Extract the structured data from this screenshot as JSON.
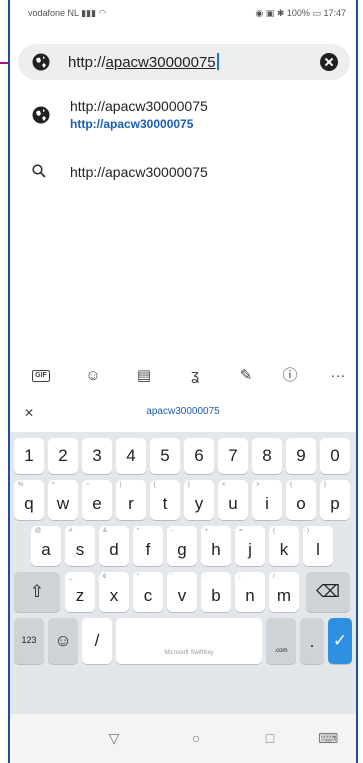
{
  "status_bar": {
    "carrier": "vodafone NL",
    "time": "17:47",
    "battery": "100%"
  },
  "url_bar": {
    "prefix": "http://",
    "typed": "apacw30000075"
  },
  "suggestions": [
    {
      "icon": "globe-icon",
      "title": "http://apacw30000075",
      "subtitle": "http://apacw30000075"
    },
    {
      "icon": "search-icon",
      "title": "http://apacw30000075"
    }
  ],
  "keyboard": {
    "suggestion_strip": "apacw30000075",
    "row_digits": [
      "1",
      "2",
      "3",
      "4",
      "5",
      "6",
      "7",
      "8",
      "9",
      "0"
    ],
    "row_q": [
      {
        "k": "q",
        "s": "%"
      },
      {
        "k": "w",
        "s": "^"
      },
      {
        "k": "e",
        "s": "~"
      },
      {
        "k": "r",
        "s": "|"
      },
      {
        "k": "t",
        "s": "["
      },
      {
        "k": "y",
        "s": "]"
      },
      {
        "k": "u",
        "s": "<"
      },
      {
        "k": "i",
        "s": ">"
      },
      {
        "k": "o",
        "s": "{"
      },
      {
        "k": "p",
        "s": "}"
      }
    ],
    "row_a": [
      {
        "k": "a",
        "s": "@"
      },
      {
        "k": "s",
        "s": "#"
      },
      {
        "k": "d",
        "s": "&"
      },
      {
        "k": "f",
        "s": "*"
      },
      {
        "k": "g",
        "s": "-"
      },
      {
        "k": "h",
        "s": "+"
      },
      {
        "k": "j",
        "s": "="
      },
      {
        "k": "k",
        "s": "("
      },
      {
        "k": "l",
        "s": ")"
      }
    ],
    "row_z": [
      {
        "k": "z",
        "s": "_"
      },
      {
        "k": "x",
        "s": "€"
      },
      {
        "k": "c",
        "s": "\""
      },
      {
        "k": "v",
        "s": "'"
      },
      {
        "k": "b",
        "s": ":"
      },
      {
        "k": "n",
        "s": ";"
      },
      {
        "k": "m",
        "s": "/"
      }
    ],
    "numbers_key": "123",
    "slash_key": "/",
    "space_label": "Microsoft SwiftKey",
    "dotcom_key": ".com",
    "period_key": "."
  },
  "colors": {
    "accent": "#1a73e8",
    "link": "#1a5fb4",
    "enter_key": "#2f8fe0",
    "marker": "#a0197a"
  }
}
